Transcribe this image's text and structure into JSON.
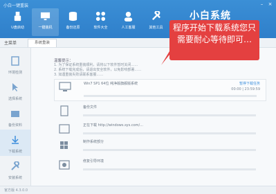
{
  "window": {
    "title": "小白一键重装"
  },
  "nav": [
    {
      "label": "U盘启动"
    },
    {
      "label": "一键装机"
    },
    {
      "label": "备份还原"
    },
    {
      "label": "软件大全"
    },
    {
      "label": "人工客服"
    },
    {
      "label": "其他工具"
    }
  ],
  "brand": {
    "name": "小白系统"
  },
  "breadcrumb": {
    "home": "主菜单",
    "tab": "系统重装"
  },
  "sidebar": [
    {
      "label": "环境检测"
    },
    {
      "label": "选择系统"
    },
    {
      "label": "备份资料"
    },
    {
      "label": "下载系统"
    },
    {
      "label": "安装系统"
    }
  ],
  "content": {
    "tips_title": "温馨提示：",
    "tips": [
      "1. 为了保证系统重装顺利，请将以下软件暂时关闭……",
      "2. 系统下载完成后，请退出安全软件，以免影响部署……",
      "3. 如遇重装失败请联系客服……"
    ],
    "tasks": [
      {
        "name": "Win7 SP1 64位 纯净版旗舰版系统",
        "right": "暂停下载任务",
        "right2": "00:00 | 23:59:59",
        "progress": 0.0,
        "icon": "monitor-icon"
      },
      {
        "name": "备份文件",
        "right": "",
        "progress": 0.0,
        "icon": "file-icon"
      },
      {
        "name": "正在下载 http://windows.sys.com/...",
        "right": "",
        "progress": 0.0,
        "icon": "download-icon"
      },
      {
        "name": "制作系统部分",
        "right": "",
        "progress": 0.0,
        "icon": "windows-icon"
      },
      {
        "name": "修复引导环境",
        "right": "",
        "progress": 0.0,
        "icon": "disk-icon"
      }
    ]
  },
  "callout": {
    "text": "程序开始下载系统您只需要耐心等待即可…"
  },
  "status": {
    "left": "官方版 4.3.0.0",
    "right": ""
  },
  "colors": {
    "primary": "#2f7fca",
    "accent": "#e44040"
  }
}
